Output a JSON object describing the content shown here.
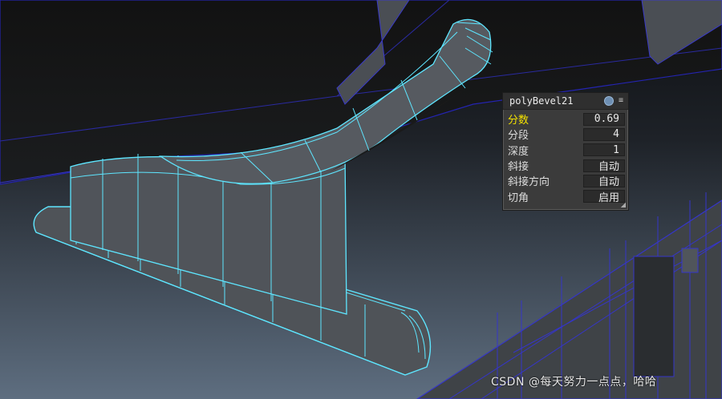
{
  "hud": {
    "title": "polyBevel21",
    "rows": [
      {
        "label": "分数",
        "value": "0.69",
        "active": true
      },
      {
        "label": "分段",
        "value": "4"
      },
      {
        "label": "深度",
        "value": "1"
      },
      {
        "label": "斜接",
        "value": "自动"
      },
      {
        "label": "斜接方向",
        "value": "自动"
      },
      {
        "label": "切角",
        "value": "启用"
      }
    ]
  },
  "watermark": "CSDN @每天努力一点点，哈哈",
  "colors": {
    "wire": "#5ee6ff",
    "highlight": "#f3e100",
    "model_fill": "#4f5358"
  }
}
